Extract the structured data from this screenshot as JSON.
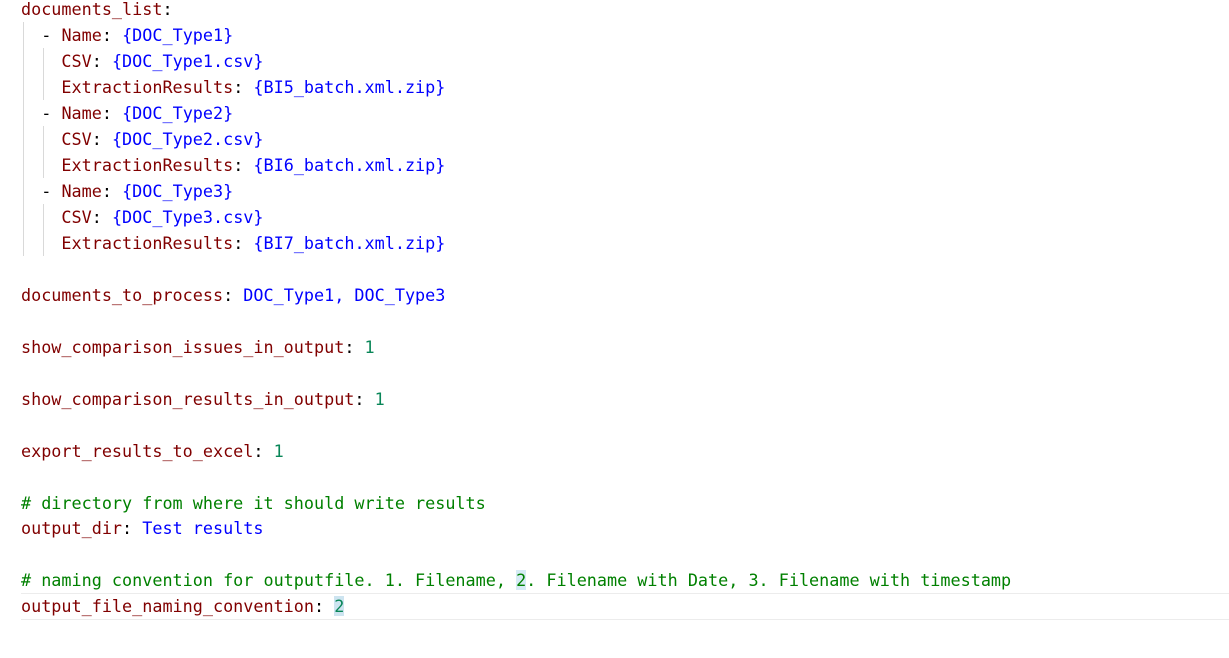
{
  "editor": {
    "documents_list_key": "documents_list",
    "documents": [
      {
        "name_key": "Name",
        "name": "{DOC_Type1}",
        "csv_key": "CSV",
        "csv": "{DOC_Type1.csv}",
        "extraction_key": "ExtractionResults",
        "extraction": "{BI5_batch.xml.zip}"
      },
      {
        "name_key": "Name",
        "name": "{DOC_Type2}",
        "csv_key": "CSV",
        "csv": "{DOC_Type2.csv}",
        "extraction_key": "ExtractionResults",
        "extraction": "{BI6_batch.xml.zip}"
      },
      {
        "name_key": "Name",
        "name": "{DOC_Type3}",
        "csv_key": "CSV",
        "csv": "{DOC_Type3.csv}",
        "extraction_key": "ExtractionResults",
        "extraction": "{BI7_batch.xml.zip}"
      }
    ],
    "documents_to_process_key": "documents_to_process",
    "documents_to_process": "DOC_Type1, DOC_Type3",
    "show_issues_key": "show_comparison_issues_in_output",
    "show_issues": "1",
    "show_results_key": "show_comparison_results_in_output",
    "show_results": "1",
    "export_key": "export_results_to_excel",
    "export": "1",
    "output_dir_comment": "# directory from where it should write results",
    "output_dir_key": "output_dir",
    "output_dir": "Test results",
    "naming_comment_before": "# naming convention for outputfile. 1. Filename, ",
    "naming_comment_highlight": "2",
    "naming_comment_after": ". Filename with Date, 3. Filename with timestamp",
    "naming_key": "output_file_naming_convention",
    "naming_value": "2"
  },
  "colors": {
    "key": "#800000",
    "string_value": "#0000ff",
    "number_value": "#098658",
    "comment": "#008000",
    "highlight": "#d6ebf5"
  }
}
